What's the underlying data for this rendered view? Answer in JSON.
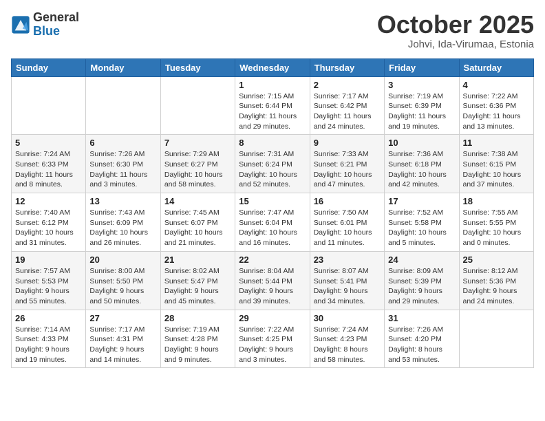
{
  "logo": {
    "line1": "General",
    "line2": "Blue"
  },
  "title": "October 2025",
  "subtitle": "Johvi, Ida-Virumaa, Estonia",
  "weekdays": [
    "Sunday",
    "Monday",
    "Tuesday",
    "Wednesday",
    "Thursday",
    "Friday",
    "Saturday"
  ],
  "weeks": [
    [
      {
        "day": "",
        "info": ""
      },
      {
        "day": "",
        "info": ""
      },
      {
        "day": "",
        "info": ""
      },
      {
        "day": "1",
        "info": "Sunrise: 7:15 AM\nSunset: 6:44 PM\nDaylight: 11 hours\nand 29 minutes."
      },
      {
        "day": "2",
        "info": "Sunrise: 7:17 AM\nSunset: 6:42 PM\nDaylight: 11 hours\nand 24 minutes."
      },
      {
        "day": "3",
        "info": "Sunrise: 7:19 AM\nSunset: 6:39 PM\nDaylight: 11 hours\nand 19 minutes."
      },
      {
        "day": "4",
        "info": "Sunrise: 7:22 AM\nSunset: 6:36 PM\nDaylight: 11 hours\nand 13 minutes."
      }
    ],
    [
      {
        "day": "5",
        "info": "Sunrise: 7:24 AM\nSunset: 6:33 PM\nDaylight: 11 hours\nand 8 minutes."
      },
      {
        "day": "6",
        "info": "Sunrise: 7:26 AM\nSunset: 6:30 PM\nDaylight: 11 hours\nand 3 minutes."
      },
      {
        "day": "7",
        "info": "Sunrise: 7:29 AM\nSunset: 6:27 PM\nDaylight: 10 hours\nand 58 minutes."
      },
      {
        "day": "8",
        "info": "Sunrise: 7:31 AM\nSunset: 6:24 PM\nDaylight: 10 hours\nand 52 minutes."
      },
      {
        "day": "9",
        "info": "Sunrise: 7:33 AM\nSunset: 6:21 PM\nDaylight: 10 hours\nand 47 minutes."
      },
      {
        "day": "10",
        "info": "Sunrise: 7:36 AM\nSunset: 6:18 PM\nDaylight: 10 hours\nand 42 minutes."
      },
      {
        "day": "11",
        "info": "Sunrise: 7:38 AM\nSunset: 6:15 PM\nDaylight: 10 hours\nand 37 minutes."
      }
    ],
    [
      {
        "day": "12",
        "info": "Sunrise: 7:40 AM\nSunset: 6:12 PM\nDaylight: 10 hours\nand 31 minutes."
      },
      {
        "day": "13",
        "info": "Sunrise: 7:43 AM\nSunset: 6:09 PM\nDaylight: 10 hours\nand 26 minutes."
      },
      {
        "day": "14",
        "info": "Sunrise: 7:45 AM\nSunset: 6:07 PM\nDaylight: 10 hours\nand 21 minutes."
      },
      {
        "day": "15",
        "info": "Sunrise: 7:47 AM\nSunset: 6:04 PM\nDaylight: 10 hours\nand 16 minutes."
      },
      {
        "day": "16",
        "info": "Sunrise: 7:50 AM\nSunset: 6:01 PM\nDaylight: 10 hours\nand 11 minutes."
      },
      {
        "day": "17",
        "info": "Sunrise: 7:52 AM\nSunset: 5:58 PM\nDaylight: 10 hours\nand 5 minutes."
      },
      {
        "day": "18",
        "info": "Sunrise: 7:55 AM\nSunset: 5:55 PM\nDaylight: 10 hours\nand 0 minutes."
      }
    ],
    [
      {
        "day": "19",
        "info": "Sunrise: 7:57 AM\nSunset: 5:53 PM\nDaylight: 9 hours\nand 55 minutes."
      },
      {
        "day": "20",
        "info": "Sunrise: 8:00 AM\nSunset: 5:50 PM\nDaylight: 9 hours\nand 50 minutes."
      },
      {
        "day": "21",
        "info": "Sunrise: 8:02 AM\nSunset: 5:47 PM\nDaylight: 9 hours\nand 45 minutes."
      },
      {
        "day": "22",
        "info": "Sunrise: 8:04 AM\nSunset: 5:44 PM\nDaylight: 9 hours\nand 39 minutes."
      },
      {
        "day": "23",
        "info": "Sunrise: 8:07 AM\nSunset: 5:41 PM\nDaylight: 9 hours\nand 34 minutes."
      },
      {
        "day": "24",
        "info": "Sunrise: 8:09 AM\nSunset: 5:39 PM\nDaylight: 9 hours\nand 29 minutes."
      },
      {
        "day": "25",
        "info": "Sunrise: 8:12 AM\nSunset: 5:36 PM\nDaylight: 9 hours\nand 24 minutes."
      }
    ],
    [
      {
        "day": "26",
        "info": "Sunrise: 7:14 AM\nSunset: 4:33 PM\nDaylight: 9 hours\nand 19 minutes."
      },
      {
        "day": "27",
        "info": "Sunrise: 7:17 AM\nSunset: 4:31 PM\nDaylight: 9 hours\nand 14 minutes."
      },
      {
        "day": "28",
        "info": "Sunrise: 7:19 AM\nSunset: 4:28 PM\nDaylight: 9 hours\nand 9 minutes."
      },
      {
        "day": "29",
        "info": "Sunrise: 7:22 AM\nSunset: 4:25 PM\nDaylight: 9 hours\nand 3 minutes."
      },
      {
        "day": "30",
        "info": "Sunrise: 7:24 AM\nSunset: 4:23 PM\nDaylight: 8 hours\nand 58 minutes."
      },
      {
        "day": "31",
        "info": "Sunrise: 7:26 AM\nSunset: 4:20 PM\nDaylight: 8 hours\nand 53 minutes."
      },
      {
        "day": "",
        "info": ""
      }
    ]
  ]
}
